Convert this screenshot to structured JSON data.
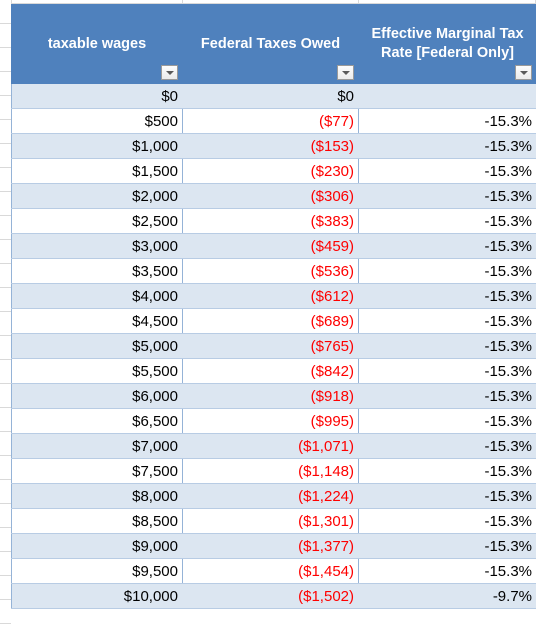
{
  "table": {
    "columns": [
      {
        "key": "wages",
        "label": "taxable wages",
        "filter_icon": "filter-dropdown-icon"
      },
      {
        "key": "taxes",
        "label": "Federal Taxes Owed",
        "filter_icon": "filter-dropdown-icon"
      },
      {
        "key": "rate",
        "label": "Effective Marginal Tax Rate [Federal Only]",
        "filter_icon": "filter-dropdown-icon"
      }
    ],
    "colors": {
      "header_background": "#4F81BD",
      "header_text": "#FFFFFF",
      "band_row_background": "#DCE6F1",
      "plain_row_background": "#FFFFFF",
      "border": "#95B3D7",
      "negative_value_text": "#FF0000",
      "value_text": "#000000"
    },
    "rows": [
      {
        "wages": "$0",
        "taxes": "$0",
        "rate": "",
        "negative": false
      },
      {
        "wages": "$500",
        "taxes": "($77)",
        "rate": "-15.3%",
        "negative": true
      },
      {
        "wages": "$1,000",
        "taxes": "($153)",
        "rate": "-15.3%",
        "negative": true
      },
      {
        "wages": "$1,500",
        "taxes": "($230)",
        "rate": "-15.3%",
        "negative": true
      },
      {
        "wages": "$2,000",
        "taxes": "($306)",
        "rate": "-15.3%",
        "negative": true
      },
      {
        "wages": "$2,500",
        "taxes": "($383)",
        "rate": "-15.3%",
        "negative": true
      },
      {
        "wages": "$3,000",
        "taxes": "($459)",
        "rate": "-15.3%",
        "negative": true
      },
      {
        "wages": "$3,500",
        "taxes": "($536)",
        "rate": "-15.3%",
        "negative": true
      },
      {
        "wages": "$4,000",
        "taxes": "($612)",
        "rate": "-15.3%",
        "negative": true
      },
      {
        "wages": "$4,500",
        "taxes": "($689)",
        "rate": "-15.3%",
        "negative": true
      },
      {
        "wages": "$5,000",
        "taxes": "($765)",
        "rate": "-15.3%",
        "negative": true
      },
      {
        "wages": "$5,500",
        "taxes": "($842)",
        "rate": "-15.3%",
        "negative": true
      },
      {
        "wages": "$6,000",
        "taxes": "($918)",
        "rate": "-15.3%",
        "negative": true
      },
      {
        "wages": "$6,500",
        "taxes": "($995)",
        "rate": "-15.3%",
        "negative": true
      },
      {
        "wages": "$7,000",
        "taxes": "($1,071)",
        "rate": "-15.3%",
        "negative": true
      },
      {
        "wages": "$7,500",
        "taxes": "($1,148)",
        "rate": "-15.3%",
        "negative": true
      },
      {
        "wages": "$8,000",
        "taxes": "($1,224)",
        "rate": "-15.3%",
        "negative": true
      },
      {
        "wages": "$8,500",
        "taxes": "($1,301)",
        "rate": "-15.3%",
        "negative": true
      },
      {
        "wages": "$9,000",
        "taxes": "($1,377)",
        "rate": "-15.3%",
        "negative": true
      },
      {
        "wages": "$9,500",
        "taxes": "($1,454)",
        "rate": "-15.3%",
        "negative": true
      },
      {
        "wages": "$10,000",
        "taxes": "($1,502)",
        "rate": "-9.7%",
        "negative": true
      }
    ]
  }
}
